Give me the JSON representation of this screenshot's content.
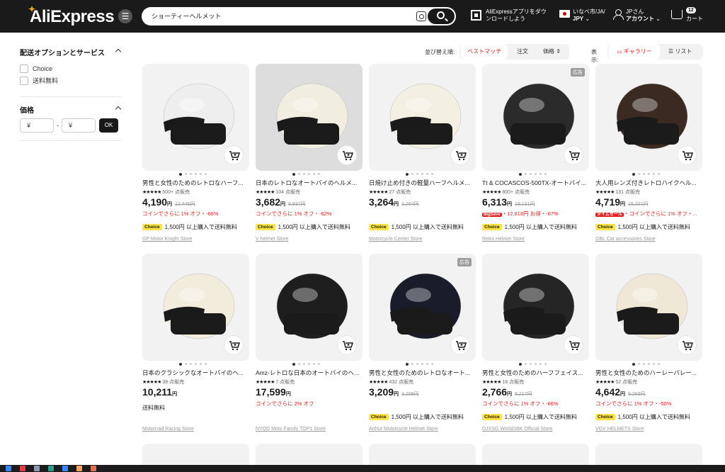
{
  "header": {
    "logo": "AliExpress",
    "search_value": "ショーティーヘルメット",
    "app_promo": "AliExpressアプリをダウンロードしよう",
    "lang_line1": "いなべ市/JA/",
    "lang_line2": "JPY",
    "account_line1": "JPさん",
    "account_line2": "アカウント",
    "cart_count": "12",
    "cart_label": "カート"
  },
  "sidebar": {
    "shipping_title": "配送オプションとサービス",
    "options": [
      "Choice",
      "送料無料"
    ],
    "price_title": "価格",
    "min_placeholder": "¥",
    "max_placeholder": "¥",
    "dash": "-",
    "ok_label": "OK"
  },
  "sortbar": {
    "sort_label": "並び替え順:",
    "sort_options": [
      "ベストマッチ",
      "注文",
      "価格"
    ],
    "view_label": "表示:",
    "view_options": [
      "ギャラリー",
      "リスト"
    ]
  },
  "products": [
    {
      "title": "男性と女性のためのレトロなハーフ...",
      "rating": "500+ 点販売",
      "price": "4,190",
      "currency": "円",
      "orig": "12,445円",
      "promo": "コインでさらに 1% オフ・-66%",
      "ship": "1,500円 以上購入で送料無料",
      "choice": true,
      "store": "GP Motor Knight Store"
    },
    {
      "title": "日本のレトロなオートバイのヘルメ...",
      "rating": "104 点販売",
      "price": "3,682",
      "currency": "円",
      "orig": "9,837円",
      "promo": "コインでさらに 1% オフ・-62%",
      "ship": "1,500円 以上購入で送料無料",
      "choice": true,
      "store": "V helmet Store"
    },
    {
      "title": "日焼け止め付きの軽量ハーフヘルメ...",
      "rating": "27 点販売",
      "price": "3,264",
      "currency": "円",
      "orig": "3,264円",
      "promo": "",
      "ship": "1,500円 以上購入で送料無料",
      "choice": true,
      "store": "Motorcycle Center Store"
    },
    {
      "title": "Tt & COCASCOS-500TX-オートバイ...",
      "rating": "800+ 点販売",
      "price": "6,313",
      "currency": "円",
      "orig": "19,131円",
      "badge": "BigSave",
      "promo": "・12,818円 お得・-67%",
      "ship": "1,500円 以上購入で送料無料",
      "choice": true,
      "store": "Retro Helmet Store",
      "ad": "広告"
    },
    {
      "title": "大人用レンズ付きレトロハイクヘル...",
      "rating": "131 点販売",
      "price": "4,719",
      "currency": "円",
      "orig": "15,221円",
      "badge": "タイムセール",
      "promo": "・コインでさらに 1% オフ・...",
      "ship": "1,500円 以上購入で送料無料",
      "choice": true,
      "store": "GBL Car accessories Store"
    },
    {
      "title": "日本のクラシックなオートバイのヘ...",
      "rating": "38 点販売",
      "price": "10,211",
      "currency": "円",
      "orig": "",
      "promo": "",
      "ship": "送料無料",
      "choice": false,
      "store": "Motorrrad Racing Store"
    },
    {
      "title": "Amz-レトロな日本のオートバイのヘル...",
      "rating": "7 点販売",
      "price": "17,599",
      "currency": "円",
      "orig": "",
      "promo": "コインでさらに 2% オフ",
      "ship": "",
      "choice": false,
      "store": "NYQD Moto Family TOP1 Store"
    },
    {
      "title": "男性と女性のためのレトロなオート...",
      "rating": "432 点販売",
      "price": "3,209",
      "currency": "円",
      "orig": "3,209円",
      "promo": "",
      "ship": "1,500円 以上購入で送料無料",
      "choice": true,
      "store": "Arthur Motorcycle Helmet Store",
      "ad": "広告"
    },
    {
      "title": "男性と女性のためのハーフフェイス...",
      "rating": "18 点販売",
      "price": "2,766",
      "currency": "円",
      "orig": "8,217円",
      "promo": "コインでさらに 1% オフ・-66%",
      "ship": "1,500円 以上購入で送料無料",
      "choice": true,
      "store": "DJXSG WorldSBK Official Store"
    },
    {
      "title": "男性と女性のためのハーレーバレー...",
      "rating": "52 点販売",
      "price": "4,642",
      "currency": "円",
      "orig": "9,283円",
      "promo": "コインでさらに 1% オフ・-50%",
      "ship": "1,500円 以上購入で送料無料",
      "choice": true,
      "store": "VGV HELMETS Store"
    }
  ],
  "stars": "★★★★★",
  "choice_label": "Choice"
}
